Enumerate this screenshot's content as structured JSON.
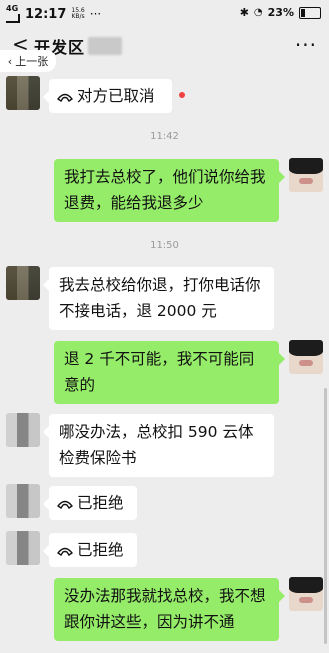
{
  "status_bar": {
    "signal": "4G",
    "net_speed": "15.6",
    "net_unit": "KB/s",
    "time": "12:17",
    "more": "···",
    "battery_percent": "23%"
  },
  "header": {
    "back": "<",
    "title": "开发区",
    "more": "···",
    "prev_page": "上一张"
  },
  "messages": [
    {
      "side": "left",
      "type": "call",
      "text": "对方已取消",
      "unread": true
    },
    {
      "type": "time",
      "text": "11:42"
    },
    {
      "side": "right",
      "type": "text",
      "text": "我打去总校了，他们说你给我退费，能给我退多少"
    },
    {
      "type": "time",
      "text": "11:50"
    },
    {
      "side": "left",
      "type": "text",
      "text": "我去总校给你退，打你电话你不接电话，退 2000 元"
    },
    {
      "side": "right",
      "type": "text",
      "text": "退 2 千不可能，我不可能同意的"
    },
    {
      "side": "left",
      "type": "text",
      "text": "哪没办法，总校扣 590 云体检费保险书"
    },
    {
      "side": "left",
      "type": "call",
      "text": "已拒绝"
    },
    {
      "side": "left",
      "type": "call",
      "text": "已拒绝"
    },
    {
      "side": "right",
      "type": "text",
      "text": "没办法那我就找总校，我不想跟你讲这些，因为讲不通"
    }
  ],
  "colors": {
    "background": "#ededed",
    "sent_bubble": "#95ec69",
    "received_bubble": "#ffffff",
    "unread_dot": "#f04040"
  },
  "icons": {
    "call": "phone-hangup-icon",
    "back": "chevron-left-icon",
    "more": "more-dots-icon"
  }
}
